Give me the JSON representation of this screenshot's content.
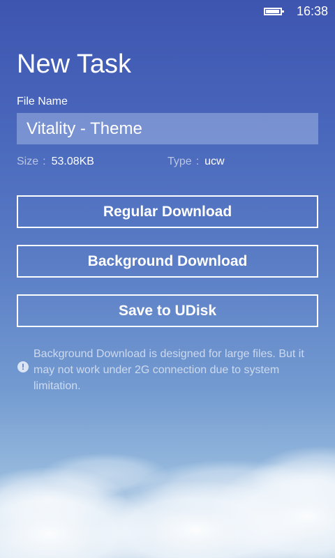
{
  "status_bar": {
    "time": "16:38",
    "battery_level": 0.85
  },
  "page": {
    "title": "New Task"
  },
  "file": {
    "name_label": "File Name",
    "name_value": "Vitality - Theme",
    "size_label": "Size",
    "size_value": "53.08KB",
    "type_label": "Type",
    "type_value": "ucw",
    "separator": ":"
  },
  "actions": {
    "regular_download": "Regular Download",
    "background_download": "Background Download",
    "save_to_udisk": "Save to UDisk"
  },
  "info": {
    "icon": "exclamation-icon",
    "glyph": "!",
    "text": "Background Download is designed for large files. But it may not work under 2G connection due to system limitation."
  },
  "colors": {
    "accent": "#ffffff",
    "background_top": "#3e55b0",
    "background_bottom": "#b7cee4"
  }
}
